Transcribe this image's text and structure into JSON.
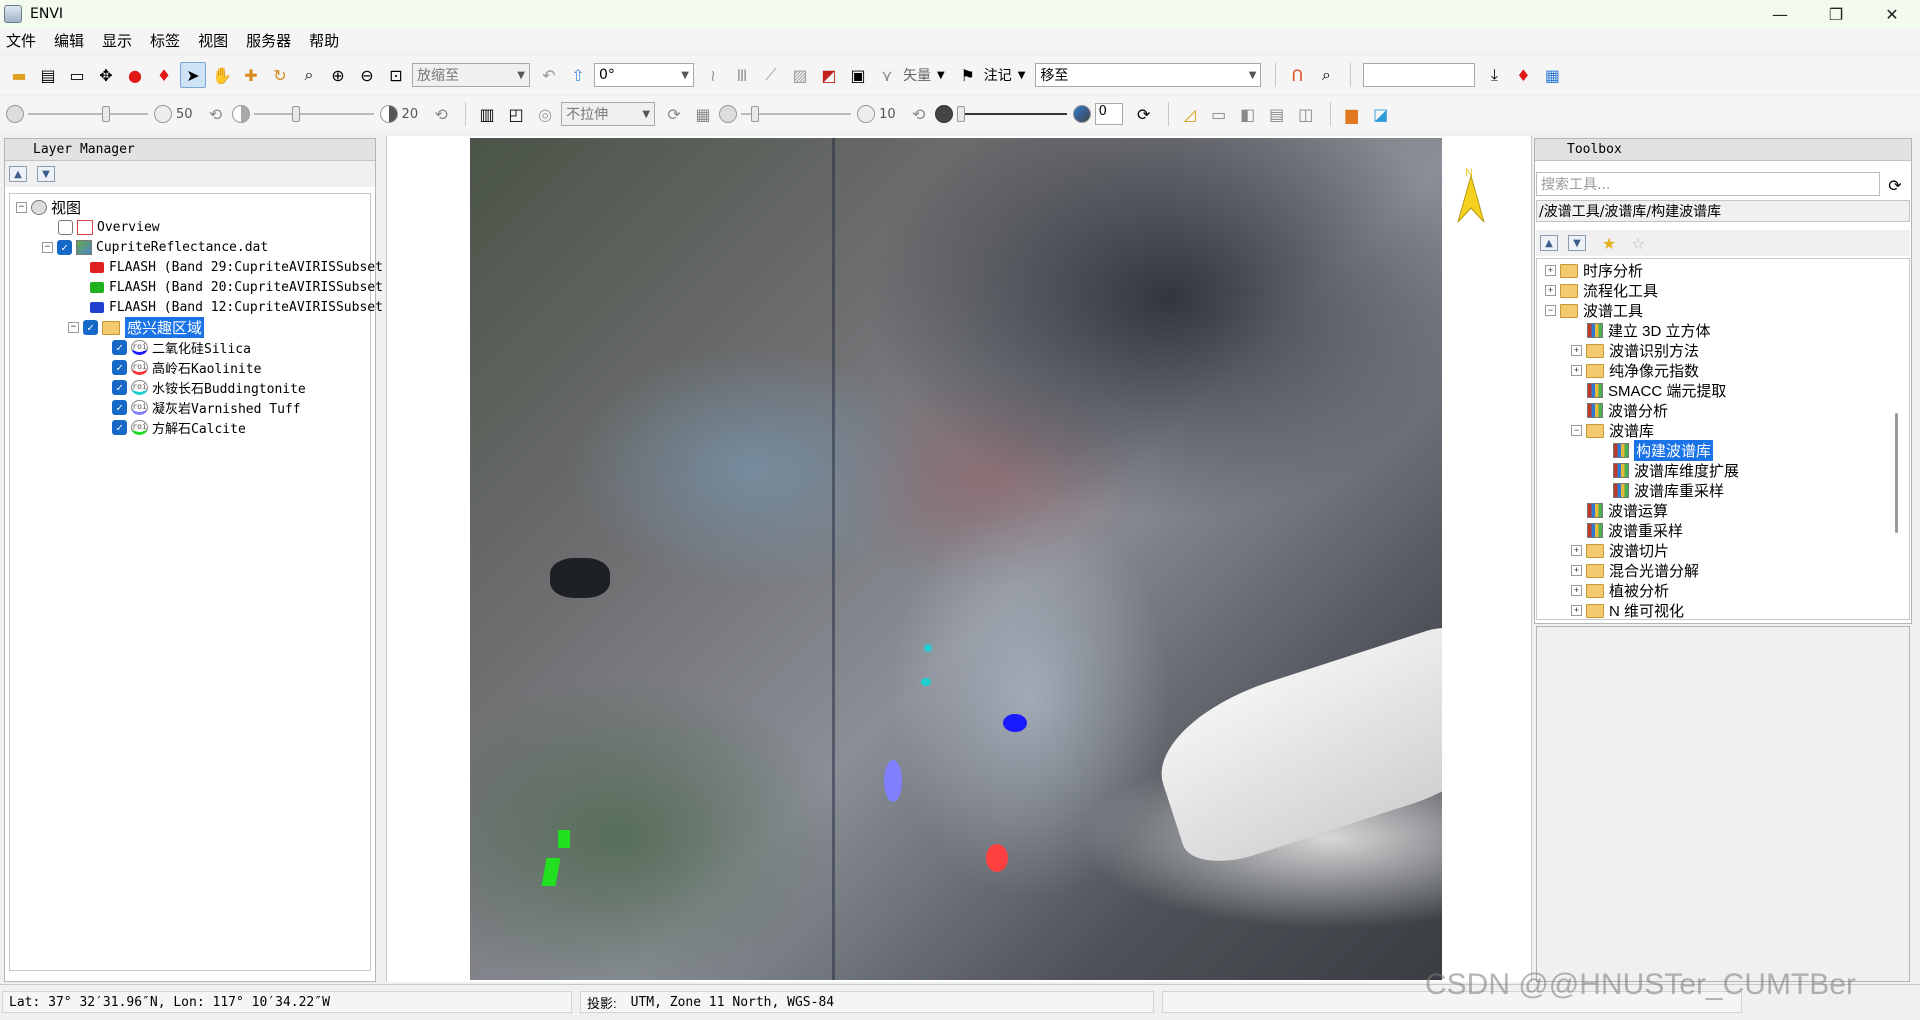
{
  "window": {
    "title": "ENVI",
    "minimize": "—",
    "restore": "❐",
    "close": "✕"
  },
  "menu": [
    "文件",
    "编辑",
    "显示",
    "标签",
    "视图",
    "服务器",
    "帮助"
  ],
  "toolbar1": {
    "zoom_combo": "放缩至",
    "rotate_combo": "0°",
    "vector_label": "矢量",
    "annotation_label": "注记",
    "goto_combo": "移至",
    "search_value": ""
  },
  "toolbar2": {
    "brightness_value": "50",
    "contrast_value": "20",
    "stretch_combo": "不拉伸",
    "sharpen_value": "10",
    "transparency_value": "0"
  },
  "layer_manager": {
    "title": "Layer Manager",
    "items": [
      {
        "label": "视图",
        "type": "view"
      },
      {
        "label": "Overview",
        "type": "overview",
        "checked": false
      },
      {
        "label": "CupriteReflectance.dat",
        "type": "raster",
        "checked": true
      },
      {
        "label": "FLAASH (Band 29:CupriteAVIRISSubset.",
        "type": "band",
        "color": "#e02020"
      },
      {
        "label": "FLAASH (Band 20:CupriteAVIRISSubset.",
        "type": "band",
        "color": "#20b020"
      },
      {
        "label": "FLAASH (Band 12:CupriteAVIRISSubset.",
        "type": "band",
        "color": "#2040d0"
      },
      {
        "label": "感兴趣区域",
        "type": "folder",
        "checked": true,
        "selected": true
      },
      {
        "label": "二氧化硅Silica",
        "type": "roi",
        "checked": true,
        "color": "#1a1aff"
      },
      {
        "label": "高岭石Kaolinite",
        "type": "roi",
        "checked": true,
        "color": "#ff3030"
      },
      {
        "label": "水铵长石Buddingtonite",
        "type": "roi",
        "checked": true,
        "color": "#20d0d0"
      },
      {
        "label": "凝灰岩Varnished Tuff",
        "type": "roi",
        "checked": true,
        "color": "#8080ff"
      },
      {
        "label": "方解石Calcite",
        "type": "roi",
        "checked": true,
        "color": "#20e020"
      }
    ]
  },
  "toolbox": {
    "title": "Toolbox",
    "search_placeholder": "搜索工具...",
    "path": "/波谱工具/波谱库/构建波谱库",
    "items": [
      {
        "label": "时序分析",
        "type": "folder"
      },
      {
        "label": "流程化工具",
        "type": "folder"
      },
      {
        "label": "波谱工具",
        "type": "folder-open"
      },
      {
        "label": "建立 3D 立方体",
        "type": "tool"
      },
      {
        "label": "波谱识别方法",
        "type": "folder"
      },
      {
        "label": "纯净像元指数",
        "type": "folder"
      },
      {
        "label": "SMACC 端元提取",
        "type": "tool"
      },
      {
        "label": "波谱分析",
        "type": "tool"
      },
      {
        "label": "波谱库",
        "type": "folder-open"
      },
      {
        "label": "构建波谱库",
        "type": "tool",
        "selected": true
      },
      {
        "label": "波谱库维度扩展",
        "type": "tool"
      },
      {
        "label": "波谱库重采样",
        "type": "tool"
      },
      {
        "label": "波谱运算",
        "type": "tool"
      },
      {
        "label": "波谱重采样",
        "type": "tool"
      },
      {
        "label": "波谱切片",
        "type": "folder"
      },
      {
        "label": "混合光谱分解",
        "type": "folder"
      },
      {
        "label": "植被分析",
        "type": "folder"
      },
      {
        "label": "N 维可视化",
        "type": "folder"
      }
    ]
  },
  "status": {
    "coords": "Lat: 37° 32′31.96″N, Lon: 117° 10′34.22″W",
    "projection_label": "投影:",
    "projection": "UTM, Zone 11 North, WGS-84"
  },
  "watermark": "CSDN @@HNUSTer_CUMTBer",
  "colors": {
    "accent": "#1b73e8",
    "north_arrow": "#f4d21f"
  }
}
